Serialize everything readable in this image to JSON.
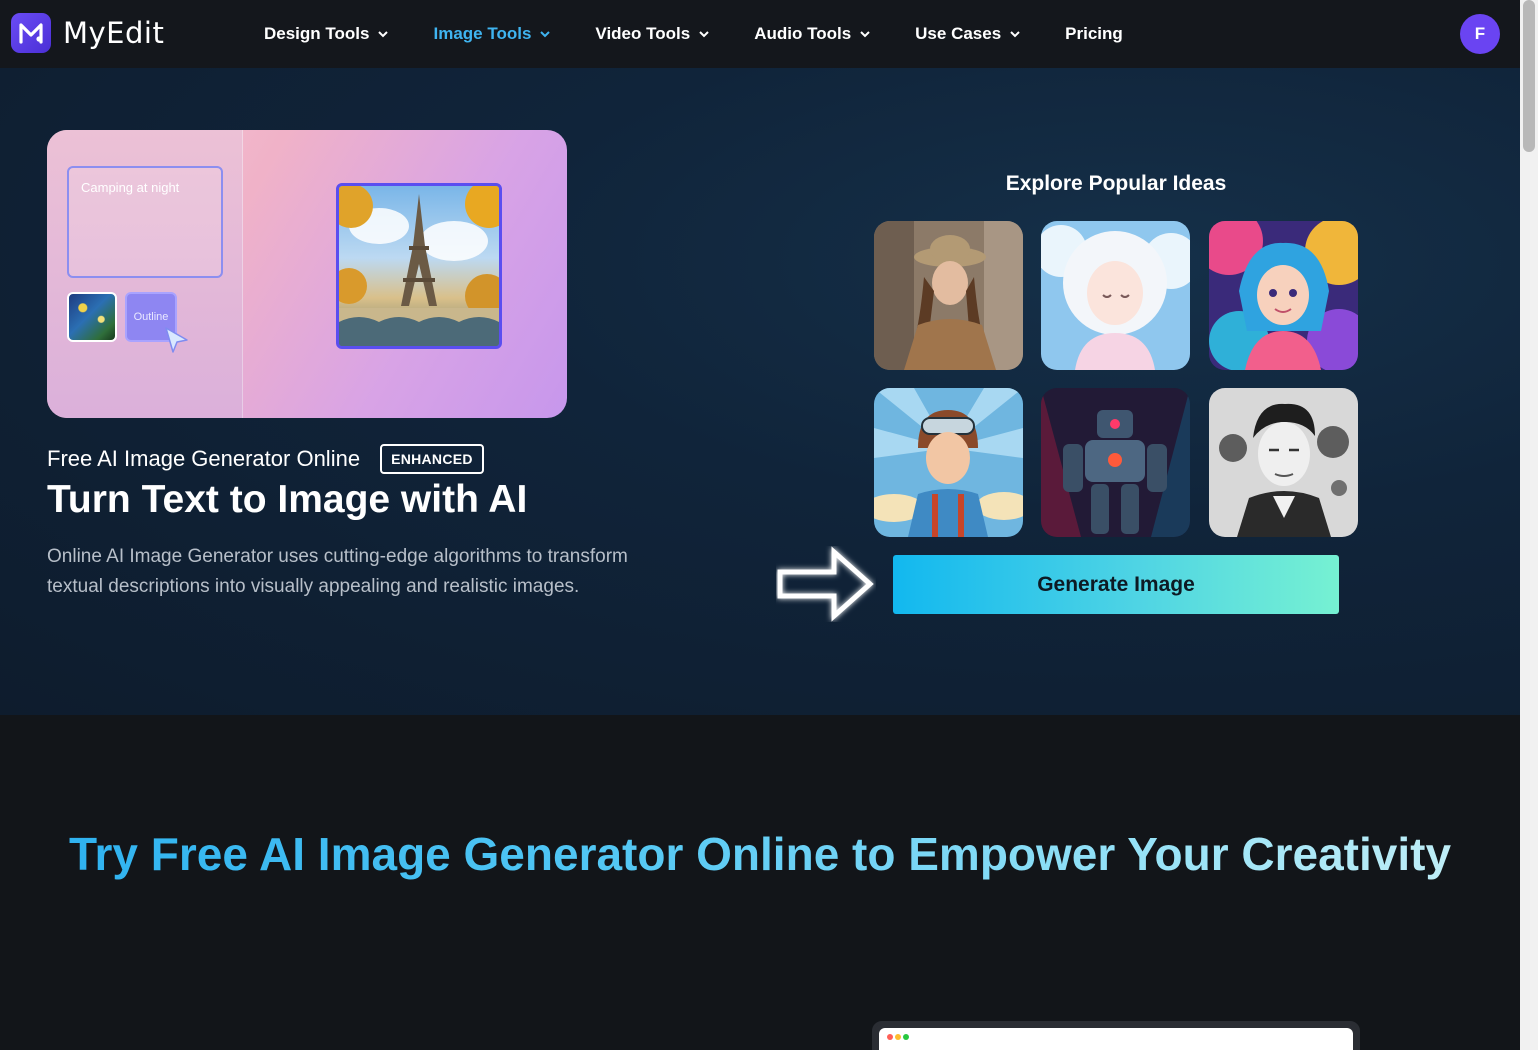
{
  "brand": {
    "name": "MyEdit"
  },
  "nav": {
    "items": [
      {
        "label": "Design Tools",
        "has_dropdown": true,
        "active": false
      },
      {
        "label": "Image Tools",
        "has_dropdown": true,
        "active": true
      },
      {
        "label": "Video Tools",
        "has_dropdown": true,
        "active": false
      },
      {
        "label": "Audio Tools",
        "has_dropdown": true,
        "active": false
      },
      {
        "label": "Use Cases",
        "has_dropdown": true,
        "active": false
      },
      {
        "label": "Pricing",
        "has_dropdown": false,
        "active": false
      }
    ],
    "avatar_initial": "F"
  },
  "hero": {
    "preview": {
      "prompt_text": "Camping at night",
      "outline_label": "Outline"
    },
    "subtitle": "Free AI Image Generator Online",
    "badge": "ENHANCED",
    "title": "Turn Text to Image with AI",
    "description": "Online AI Image Generator uses cutting-edge algorithms to transform textual descriptions into visually appealing and realistic images.",
    "ideas_title": "Explore Popular Ideas",
    "ideas": [
      {
        "name": "idea-woman-street-photo-icon"
      },
      {
        "name": "idea-anime-cloud-girl-icon"
      },
      {
        "name": "idea-colorful-anime-girl-icon"
      },
      {
        "name": "idea-pop-art-pilot-icon"
      },
      {
        "name": "idea-robot-mech-icon"
      },
      {
        "name": "idea-ink-portrait-man-icon"
      }
    ],
    "generate_label": "Generate Image"
  },
  "section2": {
    "title": "Try Free AI Image Generator Online to Empower Your Creativity"
  },
  "colors": {
    "accent": "#3fb4f0",
    "brand": "#6a44f2",
    "cta_start": "#12b8ef",
    "cta_end": "#76f1d2"
  }
}
